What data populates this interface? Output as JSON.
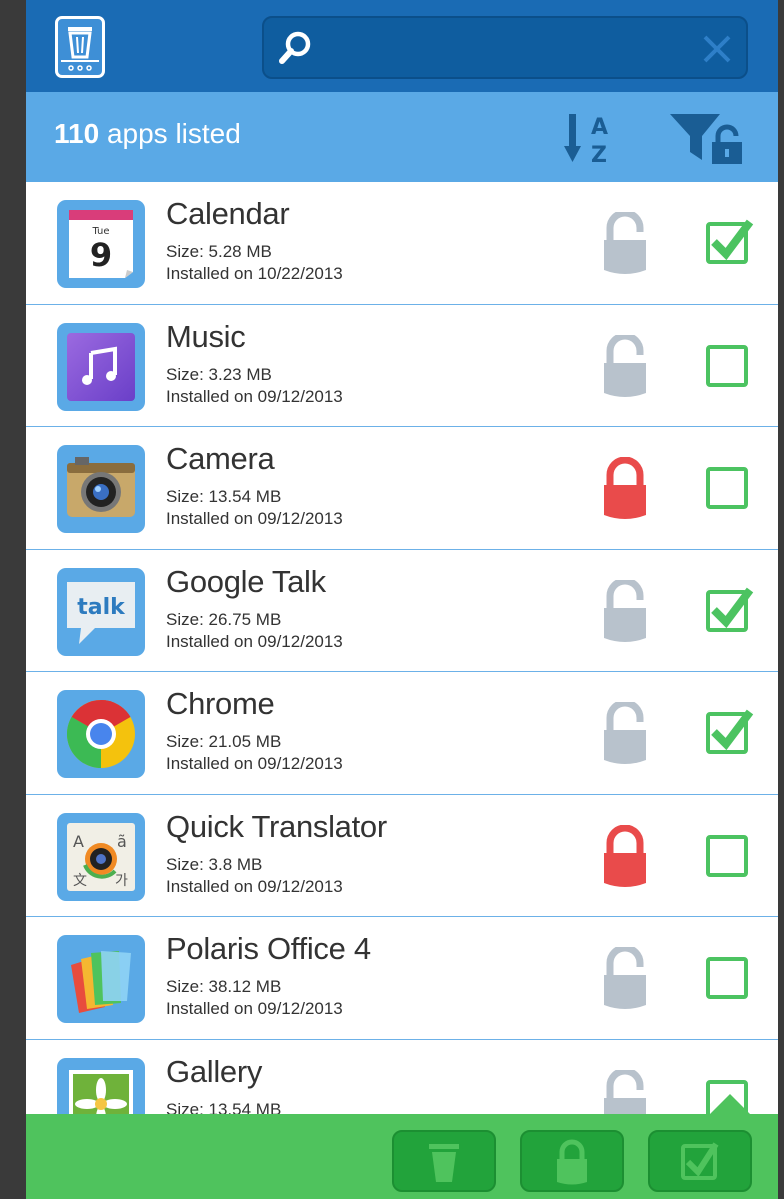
{
  "header": {
    "count_number": "110",
    "count_label": " apps listed",
    "search": {
      "placeholder": "",
      "value": ""
    }
  },
  "colors": {
    "topbar": "#1a6bb4",
    "subbar": "#5aa9e6",
    "locked": "#e94b4b",
    "unlocked": "#b8c2cc",
    "check": "#4cc361",
    "bottombar": "#4fc35d"
  },
  "apps": [
    {
      "name": "Calendar",
      "size": "Size: 5.28 MB",
      "installed": "Installed on 10/22/2013",
      "icon": "calendar-icon",
      "locked": false,
      "checked": true
    },
    {
      "name": "Music",
      "size": "Size: 3.23 MB",
      "installed": "Installed on 09/12/2013",
      "icon": "music-icon",
      "locked": false,
      "checked": false
    },
    {
      "name": "Camera",
      "size": "Size: 13.54 MB",
      "installed": "Installed on 09/12/2013",
      "icon": "camera-icon",
      "locked": true,
      "checked": false
    },
    {
      "name": "Google Talk",
      "size": "Size: 26.75 MB",
      "installed": "Installed on 09/12/2013",
      "icon": "talk-icon",
      "locked": false,
      "checked": true
    },
    {
      "name": "Chrome",
      "size": "Size: 21.05 MB",
      "installed": "Installed on 09/12/2013",
      "icon": "chrome-icon",
      "locked": false,
      "checked": true
    },
    {
      "name": "Quick Translator",
      "size": "Size: 3.8 MB",
      "installed": "Installed on 09/12/2013",
      "icon": "translator-icon",
      "locked": true,
      "checked": false
    },
    {
      "name": "Polaris Office 4",
      "size": "Size: 38.12 MB",
      "installed": "Installed on 09/12/2013",
      "icon": "office-icon",
      "locked": false,
      "checked": false
    },
    {
      "name": "Gallery",
      "size": "Size: 13.54 MB",
      "installed": "",
      "icon": "gallery-icon",
      "locked": false,
      "checked": false
    }
  ],
  "calendar_icon": {
    "day": "Tue",
    "date": "9"
  },
  "talk_icon_text": "talk"
}
